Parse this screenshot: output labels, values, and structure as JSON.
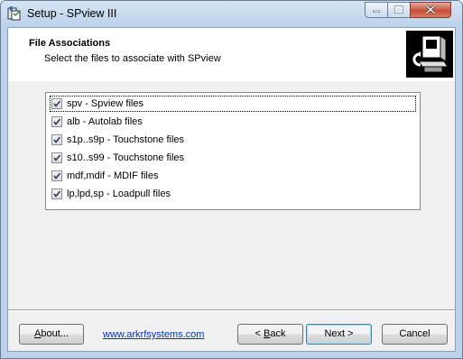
{
  "window": {
    "title": "Setup - SPview III"
  },
  "header": {
    "title": "File Associations",
    "subtitle": "Select the files to associate with SPview"
  },
  "associations": [
    {
      "label": "spv - Spview files",
      "checked": true
    },
    {
      "label": "alb - Autolab files",
      "checked": true
    },
    {
      "label": "s1p..s9p - Touchstone files",
      "checked": true
    },
    {
      "label": "s10..s99 - Touchstone files",
      "checked": true
    },
    {
      "label": "mdf,mdif - MDIF files",
      "checked": true
    },
    {
      "label": "lp,lpd,sp - Loadpull files",
      "checked": true
    }
  ],
  "footer": {
    "about_pre": "",
    "about_accel": "A",
    "about_post": "bout...",
    "website": "www.arkrfsystems.com",
    "back_pre": "< ",
    "back_accel": "B",
    "back_post": "ack",
    "next_label": "Next >",
    "cancel_label": "Cancel"
  }
}
